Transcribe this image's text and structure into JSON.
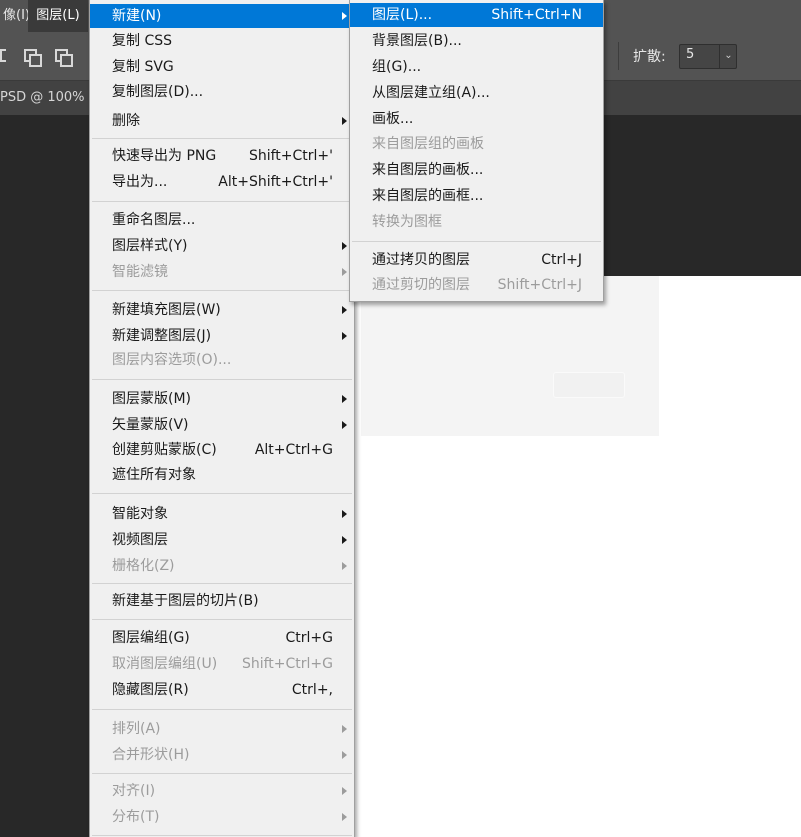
{
  "menubar": {
    "image_menu_fragment": "像(I)",
    "layer_menu": "图层(L)"
  },
  "options": {
    "expand_label": "扩散:",
    "expand_value": "5"
  },
  "document_tab": {
    "title_fragment": "PSD @ 100%"
  },
  "main_menu": {
    "items": [
      {
        "label": "新建(N)",
        "shortcut": "",
        "submenu": true,
        "enabled": true,
        "highlighted": true
      },
      {
        "label": "复制 CSS",
        "shortcut": "",
        "submenu": false,
        "enabled": true
      },
      {
        "label": "复制 SVG",
        "shortcut": "",
        "submenu": false,
        "enabled": true
      },
      {
        "label": "复制图层(D)...",
        "shortcut": "",
        "submenu": false,
        "enabled": true
      },
      {
        "label": "删除",
        "shortcut": "",
        "submenu": true,
        "enabled": true
      },
      {
        "label": "快速导出为 PNG",
        "shortcut": "Shift+Ctrl+'",
        "submenu": false,
        "enabled": true
      },
      {
        "label": "导出为...",
        "shortcut": "Alt+Shift+Ctrl+'",
        "submenu": false,
        "enabled": true
      },
      {
        "label": "重命名图层...",
        "shortcut": "",
        "submenu": false,
        "enabled": true
      },
      {
        "label": "图层样式(Y)",
        "shortcut": "",
        "submenu": true,
        "enabled": true
      },
      {
        "label": "智能滤镜",
        "shortcut": "",
        "submenu": true,
        "enabled": false
      },
      {
        "label": "新建填充图层(W)",
        "shortcut": "",
        "submenu": true,
        "enabled": true
      },
      {
        "label": "新建调整图层(J)",
        "shortcut": "",
        "submenu": true,
        "enabled": true
      },
      {
        "label": "图层内容选项(O)...",
        "shortcut": "",
        "submenu": false,
        "enabled": false
      },
      {
        "label": "图层蒙版(M)",
        "shortcut": "",
        "submenu": true,
        "enabled": true
      },
      {
        "label": "矢量蒙版(V)",
        "shortcut": "",
        "submenu": true,
        "enabled": true
      },
      {
        "label": "创建剪贴蒙版(C)",
        "shortcut": "Alt+Ctrl+G",
        "submenu": false,
        "enabled": true
      },
      {
        "label": "遮住所有对象",
        "shortcut": "",
        "submenu": false,
        "enabled": true
      },
      {
        "label": "智能对象",
        "shortcut": "",
        "submenu": true,
        "enabled": true
      },
      {
        "label": "视频图层",
        "shortcut": "",
        "submenu": true,
        "enabled": true
      },
      {
        "label": "栅格化(Z)",
        "shortcut": "",
        "submenu": true,
        "enabled": false
      },
      {
        "label": "新建基于图层的切片(B)",
        "shortcut": "",
        "submenu": false,
        "enabled": true
      },
      {
        "label": "图层编组(G)",
        "shortcut": "Ctrl+G",
        "submenu": false,
        "enabled": true
      },
      {
        "label": "取消图层编组(U)",
        "shortcut": "Shift+Ctrl+G",
        "submenu": false,
        "enabled": false
      },
      {
        "label": "隐藏图层(R)",
        "shortcut": "Ctrl+,",
        "submenu": false,
        "enabled": true
      },
      {
        "label": "排列(A)",
        "shortcut": "",
        "submenu": true,
        "enabled": false
      },
      {
        "label": "合并形状(H)",
        "shortcut": "",
        "submenu": true,
        "enabled": false
      },
      {
        "label": "对齐(I)",
        "shortcut": "",
        "submenu": true,
        "enabled": false
      },
      {
        "label": "分布(T)",
        "shortcut": "",
        "submenu": true,
        "enabled": false
      }
    ]
  },
  "sub_menu": {
    "items": [
      {
        "label": "图层(L)...",
        "shortcut": "Shift+Ctrl+N",
        "enabled": true,
        "highlighted": true
      },
      {
        "label": "背景图层(B)...",
        "shortcut": "",
        "enabled": true
      },
      {
        "label": "组(G)...",
        "shortcut": "",
        "enabled": true
      },
      {
        "label": "从图层建立组(A)...",
        "shortcut": "",
        "enabled": true
      },
      {
        "label": "画板...",
        "shortcut": "",
        "enabled": true
      },
      {
        "label": "来自图层组的画板",
        "shortcut": "",
        "enabled": false
      },
      {
        "label": "来自图层的画板...",
        "shortcut": "",
        "enabled": true
      },
      {
        "label": "来自图层的画框...",
        "shortcut": "",
        "enabled": true
      },
      {
        "label": "转换为图框",
        "shortcut": "",
        "enabled": false
      },
      {
        "label": "通过拷贝的图层",
        "shortcut": "Ctrl+J",
        "enabled": true
      },
      {
        "label": "通过剪切的图层",
        "shortcut": "Shift+Ctrl+J",
        "enabled": false
      }
    ]
  },
  "colors": {
    "highlight": "#0078d7",
    "menu_bg": "#f0f0f0",
    "disabled_text": "#9c9c9c",
    "app_bg": "#282828",
    "toolbar_bg": "#535353"
  }
}
